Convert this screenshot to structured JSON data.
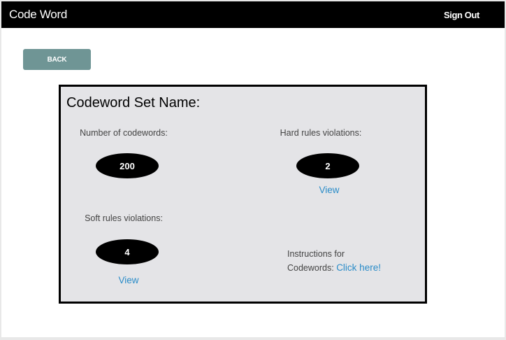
{
  "header": {
    "title": "Code Word",
    "sign_out": "Sign Out"
  },
  "back_button": "BACK",
  "panel": {
    "title": "Codeword Set Name:",
    "codewords": {
      "label": "Number of codewords:",
      "value": "200"
    },
    "hard": {
      "label": "Hard rules violations:",
      "value": "2",
      "link": "View"
    },
    "soft": {
      "label": "Soft rules violations:",
      "value": "4",
      "link": "View"
    },
    "instructions": {
      "line1": "Instructions for",
      "line2": "Codewords:",
      "link": "Click here!"
    }
  },
  "colors": {
    "navbar": "#000000",
    "back_button": "#6f9595",
    "link": "#2a8cc8",
    "panel_bg": "#e4e4e7"
  }
}
